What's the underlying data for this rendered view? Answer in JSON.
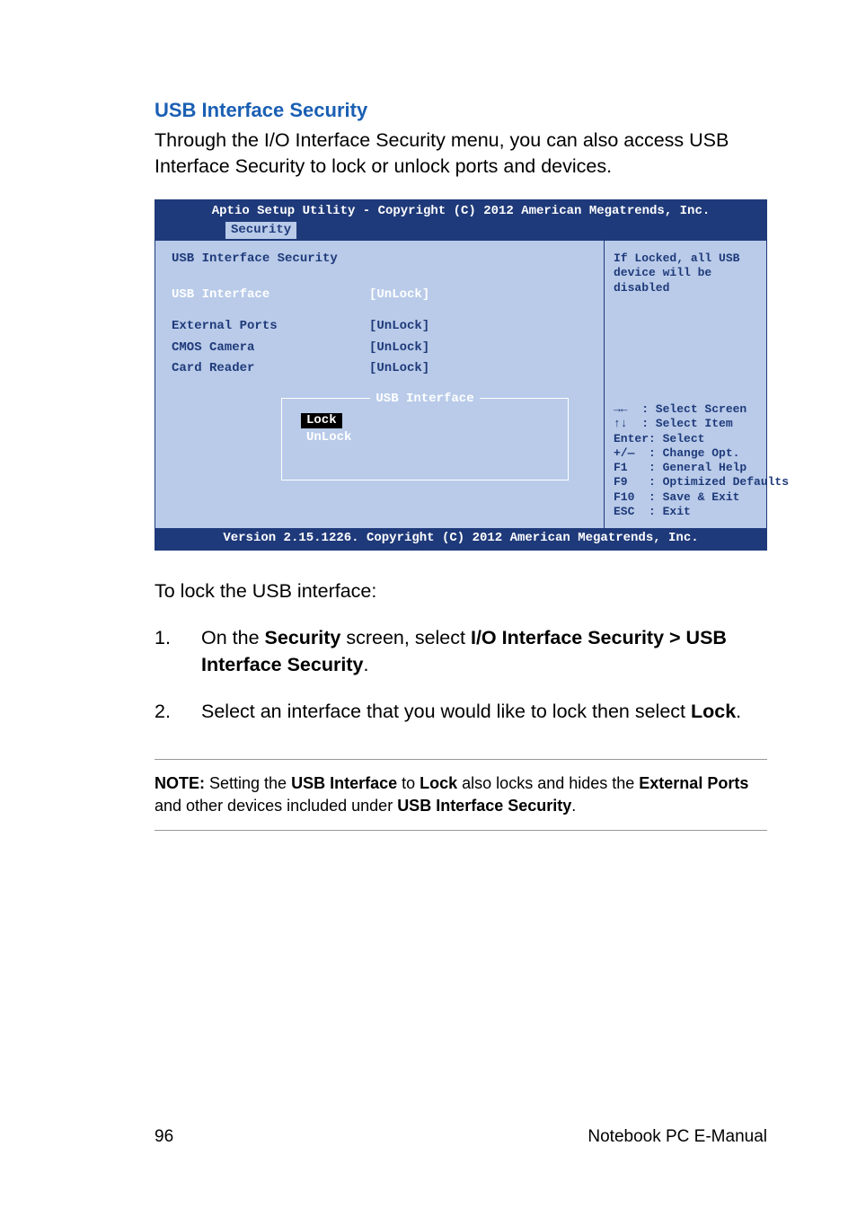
{
  "heading": "USB Interface Security",
  "intro": "Through the I/O Interface Security menu, you can also access USB Interface Security to lock or unlock ports and devices.",
  "bios": {
    "header": "Aptio Setup Utility - Copyright (C) 2012 American Megatrends, Inc.",
    "tab": "Security",
    "section_title": "USB Interface Security",
    "rows": [
      {
        "label": "USB Interface",
        "value": "[UnLock]",
        "selected": true
      },
      {
        "label": "External Ports",
        "value": "[UnLock]",
        "selected": false
      },
      {
        "label": "CMOS Camera",
        "value": "[UnLock]",
        "selected": false
      },
      {
        "label": "Card Reader",
        "value": "[UnLock]",
        "selected": false
      }
    ],
    "popup": {
      "title": "USB Interface",
      "options": [
        "Lock",
        "UnLock"
      ],
      "selected_index": 0
    },
    "help_text": "If Locked, all USB device will be disabled",
    "keys": {
      "k0": "→←  : Select Screen",
      "k1": "↑↓  : Select Item",
      "k2": "Enter: Select",
      "k3": "+/—  : Change Opt.",
      "k4": "F1   : General Help",
      "k5": "F9   : Optimized Defaults",
      "k6": "F10  : Save & Exit",
      "k7": "ESC  : Exit"
    },
    "footer": "Version 2.15.1226. Copyright (C) 2012 American Megatrends, Inc."
  },
  "lock_intro": "To lock the USB interface:",
  "steps": {
    "s1_pre": "On the ",
    "s1_b1": "Security",
    "s1_mid": " screen, select ",
    "s1_b2": "I/O Interface Security > USB Interface Security",
    "s1_post": ".",
    "s2_pre": "Select an interface that you would like to lock then select ",
    "s2_b1": "Lock",
    "s2_post": "."
  },
  "note": {
    "n_b1": "NOTE:",
    "n_t1": " Setting the ",
    "n_b2": "USB Interface",
    "n_t2": " to ",
    "n_b3": "Lock",
    "n_t3": " also locks and hides the ",
    "n_b4": "External Ports",
    "n_t4": " and other devices included under ",
    "n_b5": "USB Interface Security",
    "n_t5": "."
  },
  "footer": {
    "page": "96",
    "title": "Notebook PC E-Manual"
  }
}
